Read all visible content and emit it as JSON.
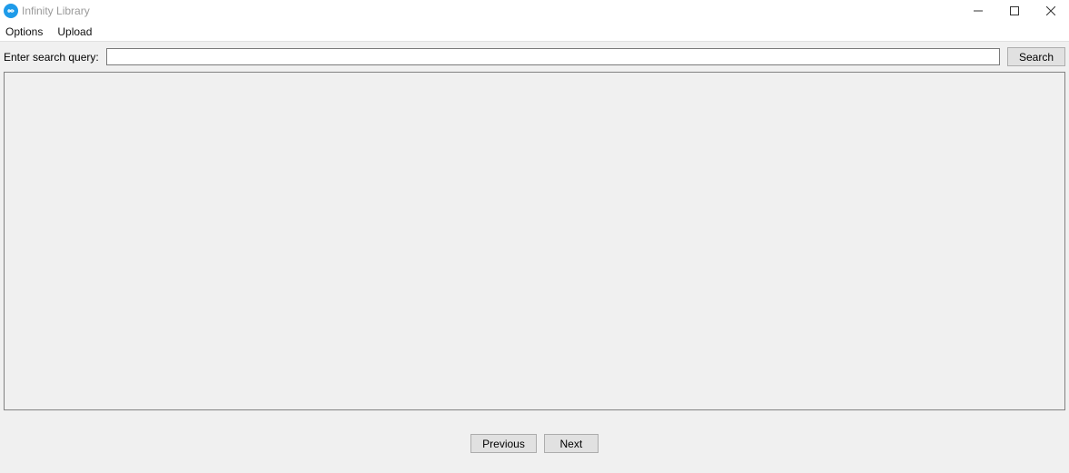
{
  "titlebar": {
    "title": "Infinity Library"
  },
  "menubar": {
    "items": [
      "Options",
      "Upload"
    ]
  },
  "search": {
    "label": "Enter search query:",
    "value": "",
    "button_label": "Search"
  },
  "pagination": {
    "prev_label": "Previous",
    "next_label": "Next"
  }
}
